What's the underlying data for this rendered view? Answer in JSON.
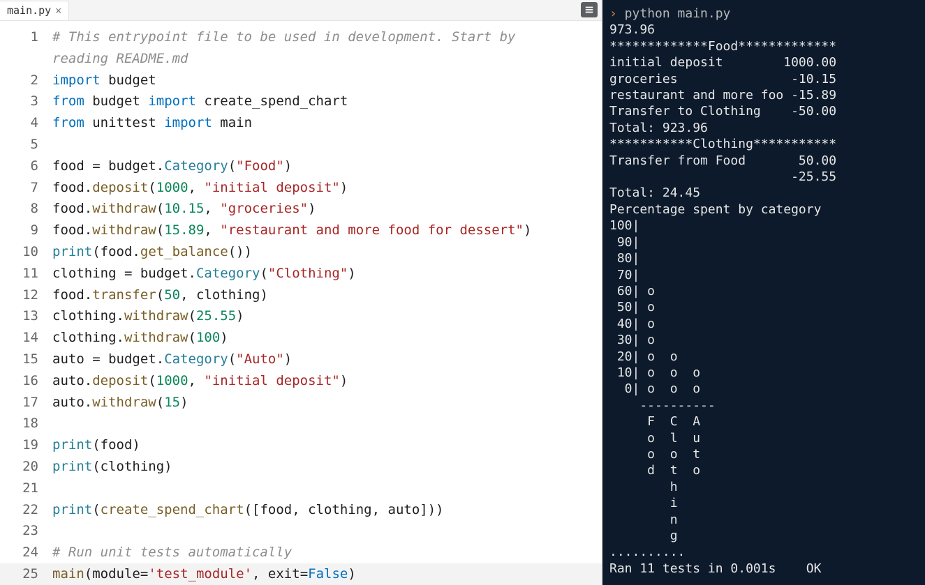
{
  "tab": {
    "filename": "main.py"
  },
  "prompt": {
    "caret": "›",
    "command": " python main.py"
  },
  "code_lines": [
    {
      "n": 1,
      "tokens": [
        [
          "comment",
          "# This entrypoint file to be used in development. Start by "
        ]
      ]
    },
    {
      "n": "",
      "tokens": [
        [
          "comment",
          "reading README.md"
        ]
      ]
    },
    {
      "n": 2,
      "tokens": [
        [
          "kw",
          "import"
        ],
        [
          "plain",
          " "
        ],
        [
          "var",
          "budget"
        ]
      ]
    },
    {
      "n": 3,
      "tokens": [
        [
          "kw",
          "from"
        ],
        [
          "plain",
          " "
        ],
        [
          "var",
          "budget"
        ],
        [
          "plain",
          " "
        ],
        [
          "kw",
          "import"
        ],
        [
          "plain",
          " "
        ],
        [
          "var",
          "create_spend_chart"
        ]
      ]
    },
    {
      "n": 4,
      "tokens": [
        [
          "kw",
          "from"
        ],
        [
          "plain",
          " "
        ],
        [
          "var",
          "unittest"
        ],
        [
          "plain",
          " "
        ],
        [
          "kw",
          "import"
        ],
        [
          "plain",
          " "
        ],
        [
          "var",
          "main"
        ]
      ]
    },
    {
      "n": 5,
      "tokens": [
        [
          "plain",
          ""
        ]
      ]
    },
    {
      "n": 6,
      "tokens": [
        [
          "var",
          "food"
        ],
        [
          "plain",
          " = "
        ],
        [
          "var",
          "budget"
        ],
        [
          "plain",
          "."
        ],
        [
          "class",
          "Category"
        ],
        [
          "plain",
          "("
        ],
        [
          "str",
          "\"Food\""
        ],
        [
          "plain",
          ")"
        ]
      ]
    },
    {
      "n": 7,
      "tokens": [
        [
          "var",
          "food"
        ],
        [
          "plain",
          "."
        ],
        [
          "method",
          "deposit"
        ],
        [
          "plain",
          "("
        ],
        [
          "num",
          "1000"
        ],
        [
          "plain",
          ", "
        ],
        [
          "str",
          "\"initial deposit\""
        ],
        [
          "plain",
          ")"
        ]
      ]
    },
    {
      "n": 8,
      "tokens": [
        [
          "var",
          "food"
        ],
        [
          "plain",
          "."
        ],
        [
          "method",
          "withdraw"
        ],
        [
          "plain",
          "("
        ],
        [
          "num",
          "10.15"
        ],
        [
          "plain",
          ", "
        ],
        [
          "str",
          "\"groceries\""
        ],
        [
          "plain",
          ")"
        ]
      ]
    },
    {
      "n": 9,
      "tokens": [
        [
          "var",
          "food"
        ],
        [
          "plain",
          "."
        ],
        [
          "method",
          "withdraw"
        ],
        [
          "plain",
          "("
        ],
        [
          "num",
          "15.89"
        ],
        [
          "plain",
          ", "
        ],
        [
          "str",
          "\"restaurant and more food for dessert\""
        ],
        [
          "plain",
          ")"
        ]
      ]
    },
    {
      "n": 10,
      "tokens": [
        [
          "builtin",
          "print"
        ],
        [
          "plain",
          "("
        ],
        [
          "var",
          "food"
        ],
        [
          "plain",
          "."
        ],
        [
          "method",
          "get_balance"
        ],
        [
          "plain",
          "())"
        ]
      ]
    },
    {
      "n": 11,
      "tokens": [
        [
          "var",
          "clothing"
        ],
        [
          "plain",
          " = "
        ],
        [
          "var",
          "budget"
        ],
        [
          "plain",
          "."
        ],
        [
          "class",
          "Category"
        ],
        [
          "plain",
          "("
        ],
        [
          "str",
          "\"Clothing\""
        ],
        [
          "plain",
          ")"
        ]
      ]
    },
    {
      "n": 12,
      "tokens": [
        [
          "var",
          "food"
        ],
        [
          "plain",
          "."
        ],
        [
          "method",
          "transfer"
        ],
        [
          "plain",
          "("
        ],
        [
          "num",
          "50"
        ],
        [
          "plain",
          ", "
        ],
        [
          "var",
          "clothing"
        ],
        [
          "plain",
          ")"
        ]
      ]
    },
    {
      "n": 13,
      "tokens": [
        [
          "var",
          "clothing"
        ],
        [
          "plain",
          "."
        ],
        [
          "method",
          "withdraw"
        ],
        [
          "plain",
          "("
        ],
        [
          "num",
          "25.55"
        ],
        [
          "plain",
          ")"
        ]
      ]
    },
    {
      "n": 14,
      "tokens": [
        [
          "var",
          "clothing"
        ],
        [
          "plain",
          "."
        ],
        [
          "method",
          "withdraw"
        ],
        [
          "plain",
          "("
        ],
        [
          "num",
          "100"
        ],
        [
          "plain",
          ")"
        ]
      ]
    },
    {
      "n": 15,
      "tokens": [
        [
          "var",
          "auto"
        ],
        [
          "plain",
          " = "
        ],
        [
          "var",
          "budget"
        ],
        [
          "plain",
          "."
        ],
        [
          "class",
          "Category"
        ],
        [
          "plain",
          "("
        ],
        [
          "str",
          "\"Auto\""
        ],
        [
          "plain",
          ")"
        ]
      ]
    },
    {
      "n": 16,
      "tokens": [
        [
          "var",
          "auto"
        ],
        [
          "plain",
          "."
        ],
        [
          "method",
          "deposit"
        ],
        [
          "plain",
          "("
        ],
        [
          "num",
          "1000"
        ],
        [
          "plain",
          ", "
        ],
        [
          "str",
          "\"initial deposit\""
        ],
        [
          "plain",
          ")"
        ]
      ]
    },
    {
      "n": 17,
      "tokens": [
        [
          "var",
          "auto"
        ],
        [
          "plain",
          "."
        ],
        [
          "method",
          "withdraw"
        ],
        [
          "plain",
          "("
        ],
        [
          "num",
          "15"
        ],
        [
          "plain",
          ")"
        ]
      ]
    },
    {
      "n": 18,
      "tokens": [
        [
          "plain",
          ""
        ]
      ]
    },
    {
      "n": 19,
      "tokens": [
        [
          "builtin",
          "print"
        ],
        [
          "plain",
          "("
        ],
        [
          "var",
          "food"
        ],
        [
          "plain",
          ")"
        ]
      ]
    },
    {
      "n": 20,
      "tokens": [
        [
          "builtin",
          "print"
        ],
        [
          "plain",
          "("
        ],
        [
          "var",
          "clothing"
        ],
        [
          "plain",
          ")"
        ]
      ]
    },
    {
      "n": 21,
      "tokens": [
        [
          "plain",
          ""
        ]
      ]
    },
    {
      "n": 22,
      "tokens": [
        [
          "builtin",
          "print"
        ],
        [
          "plain",
          "("
        ],
        [
          "method",
          "create_spend_chart"
        ],
        [
          "plain",
          "(["
        ],
        [
          "var",
          "food"
        ],
        [
          "plain",
          ", "
        ],
        [
          "var",
          "clothing"
        ],
        [
          "plain",
          ", "
        ],
        [
          "var",
          "auto"
        ],
        [
          "plain",
          "]))"
        ]
      ]
    },
    {
      "n": 23,
      "tokens": [
        [
          "plain",
          ""
        ]
      ]
    },
    {
      "n": 24,
      "tokens": [
        [
          "comment",
          "# Run unit tests automatically"
        ]
      ]
    },
    {
      "n": 25,
      "current": true,
      "tokens": [
        [
          "method",
          "main"
        ],
        [
          "plain",
          "("
        ],
        [
          "var",
          "module"
        ],
        [
          "plain",
          "="
        ],
        [
          "str",
          "'test_module'"
        ],
        [
          "plain",
          ", "
        ],
        [
          "var",
          "exit"
        ],
        [
          "plain",
          "="
        ],
        [
          "kw",
          "False"
        ],
        [
          "plain",
          ")"
        ]
      ]
    }
  ],
  "terminal_lines": [
    "973.96",
    "*************Food*************",
    "initial deposit        1000.00",
    "groceries               -10.15",
    "restaurant and more foo -15.89",
    "Transfer to Clothing    -50.00",
    "Total: 923.96",
    "***********Clothing***********",
    "Transfer from Food       50.00",
    "                        -25.55",
    "Total: 24.45",
    "Percentage spent by category",
    "100|          ",
    " 90|          ",
    " 80|          ",
    " 70|          ",
    " 60| o        ",
    " 50| o        ",
    " 40| o        ",
    " 30| o        ",
    " 20| o  o     ",
    " 10| o  o  o  ",
    "  0| o  o  o  ",
    "    ----------",
    "     F  C  A  ",
    "     o  l  u  ",
    "     o  o  t  ",
    "     d  t  o  ",
    "        h     ",
    "        i     ",
    "        n     ",
    "        g     ",
    "..........",
    "Ran 11 tests in 0.001s    OK"
  ]
}
